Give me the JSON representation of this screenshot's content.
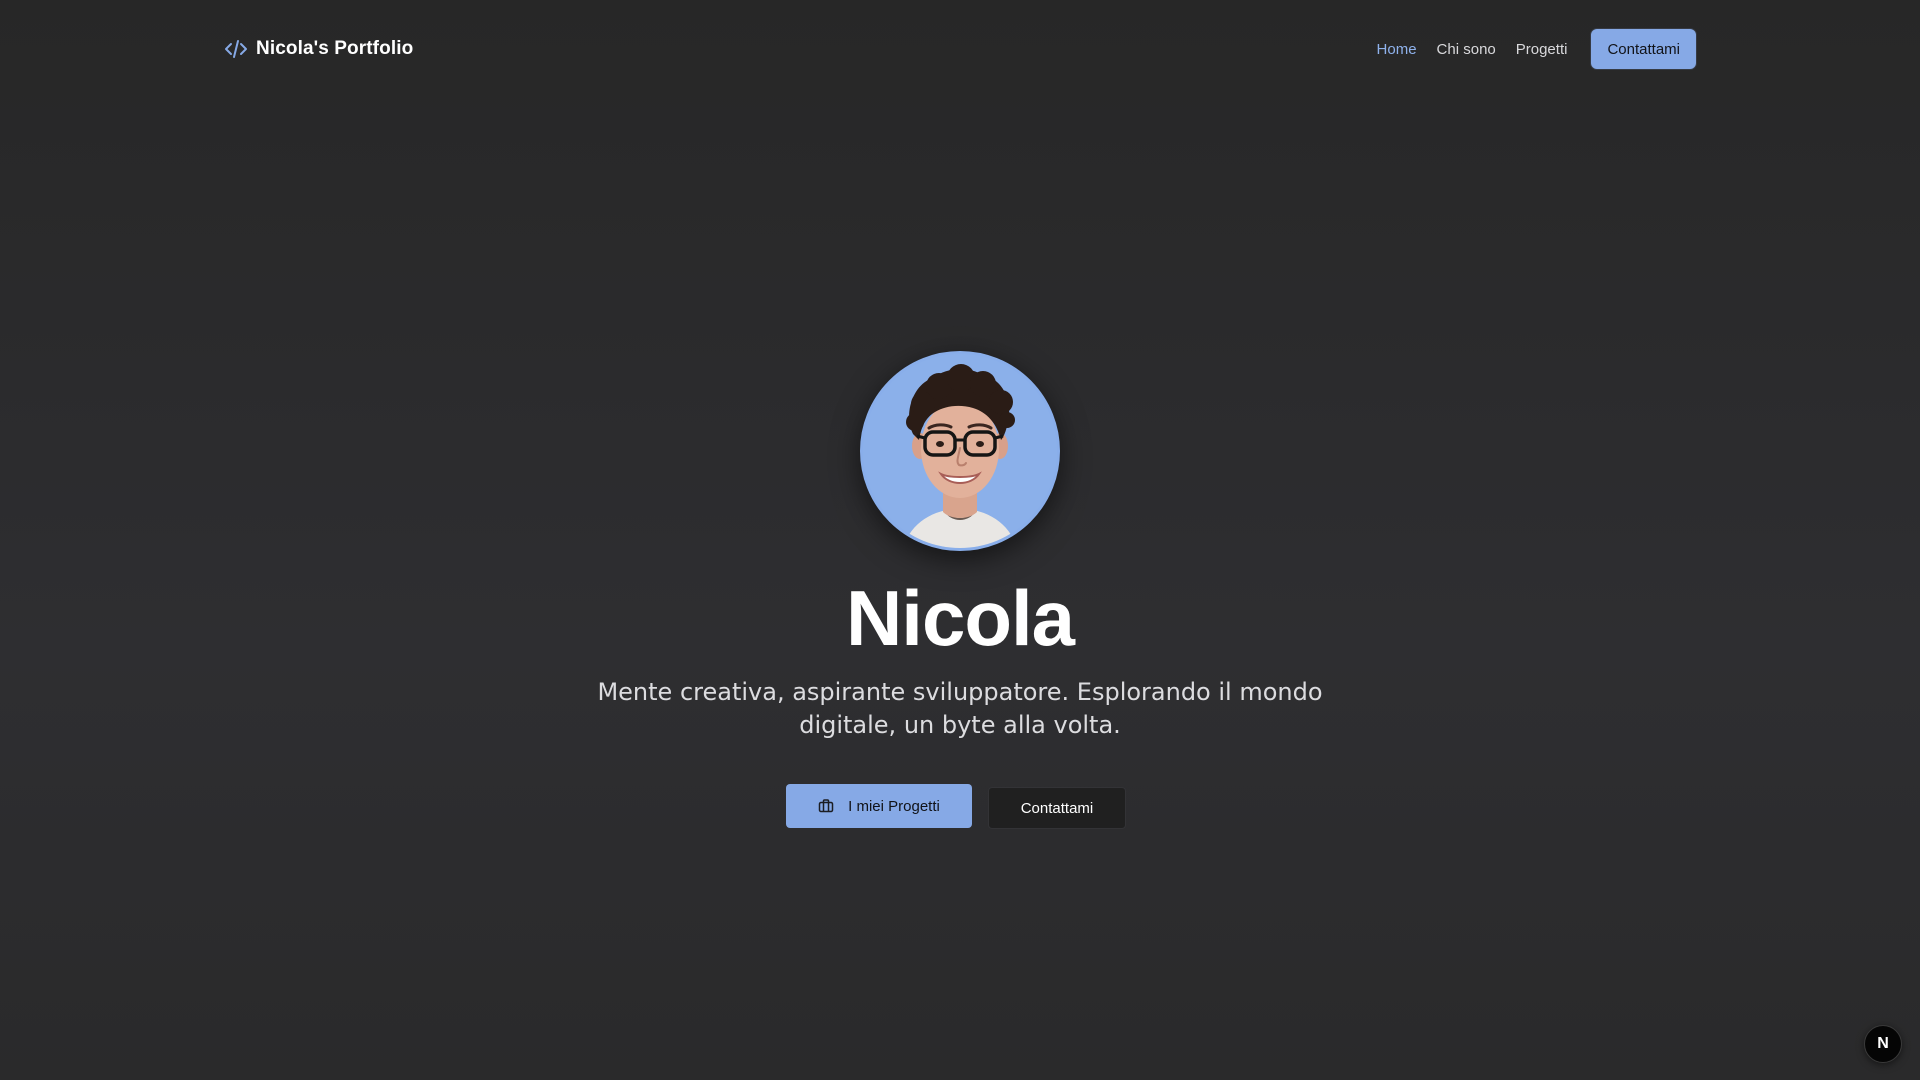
{
  "navbar": {
    "brand": {
      "icon": "code-icon",
      "name": "Nicola's Portfolio"
    },
    "links": [
      {
        "label": "Home",
        "active": true
      },
      {
        "label": "Chi sono",
        "active": false
      },
      {
        "label": "Progetti",
        "active": false
      }
    ],
    "cta_label": "Contattami"
  },
  "hero": {
    "avatar": {
      "icon": "profile-photo",
      "border_color": "#89aeea"
    },
    "title": "Nicola",
    "subtitle": "Mente creativa, aspirante sviluppatore. Esplorando il mondo digitale, un byte alla volta.",
    "primary_button": {
      "icon": "briefcase-icon",
      "label": "I miei Progetti"
    },
    "secondary_button": {
      "label": "Contattami"
    }
  },
  "floating_badge": {
    "label": "N"
  },
  "colors": {
    "accent": "#86a9e6",
    "active_link": "#8fb2ec",
    "background": "#2b2b2d"
  }
}
